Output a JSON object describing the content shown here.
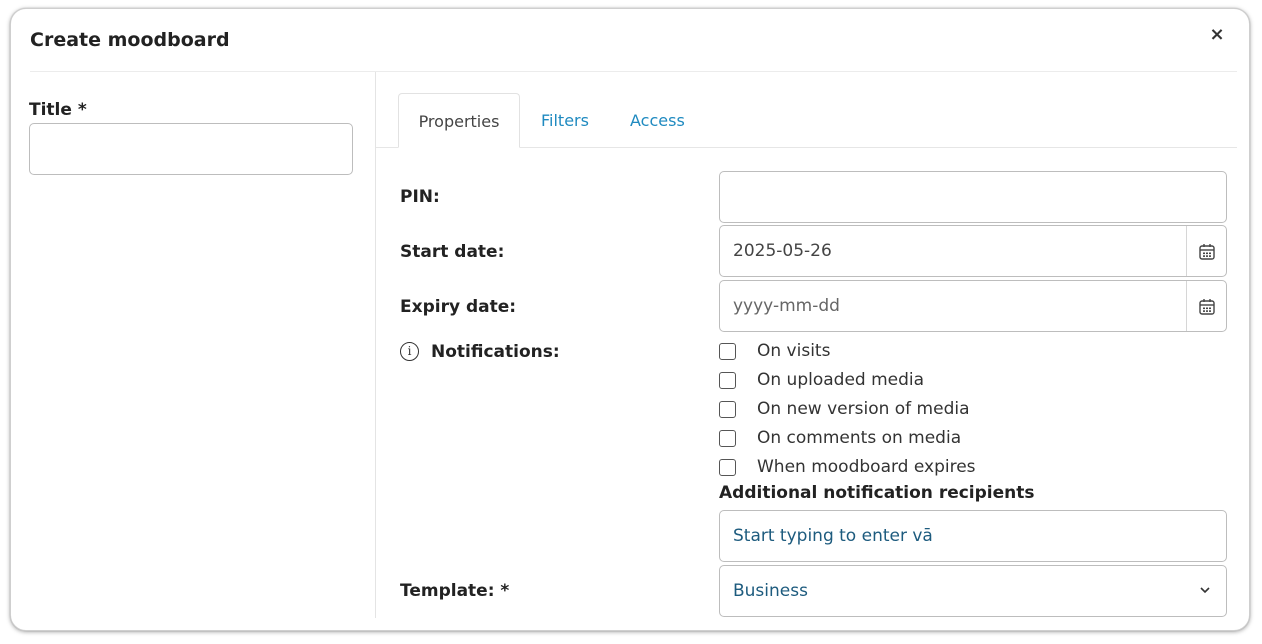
{
  "modal": {
    "title": "Create moodboard",
    "close_label": "×"
  },
  "left": {
    "title_label": "Title *",
    "title_value": ""
  },
  "tabs": [
    {
      "label": "Properties",
      "active": true
    },
    {
      "label": "Filters",
      "active": false
    },
    {
      "label": "Access",
      "active": false
    }
  ],
  "form": {
    "pin_label": "PIN:",
    "pin_value": "",
    "start_date_label": "Start date:",
    "start_date_value": "2025-05-26",
    "expiry_date_label": "Expiry date:",
    "expiry_date_placeholder": "yyyy-mm-dd",
    "notifications_label": "Notifications:",
    "notification_options": [
      {
        "label": "On visits",
        "checked": false
      },
      {
        "label": "On uploaded media",
        "checked": false
      },
      {
        "label": "On new version of media",
        "checked": false
      },
      {
        "label": "On comments on media",
        "checked": false
      },
      {
        "label": "When moodboard expires",
        "checked": false
      }
    ],
    "recipients_heading": "Additional notification recipients",
    "recipients_placeholder": "Start typing to enter vā",
    "template_label": "Template: *",
    "template_value": "Business"
  },
  "colors": {
    "link": "#1f8ac0",
    "field_text": "#1d5b7e",
    "border": "#bdbdbd"
  },
  "icons": {
    "close": "close-icon",
    "calendar": "calendar-icon",
    "info": "info-icon",
    "chevron": "chevron-down-icon"
  }
}
